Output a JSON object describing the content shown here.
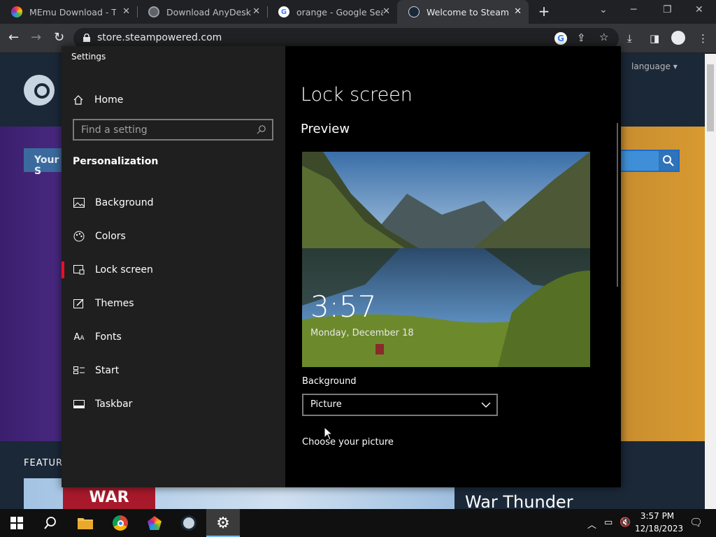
{
  "browser": {
    "tabs": [
      {
        "title": "MEmu Download - The",
        "icon": "memu-icon",
        "active": false
      },
      {
        "title": "Download AnyDesk Re",
        "icon": "globe-icon",
        "active": false
      },
      {
        "title": "orange - Google Searc",
        "icon": "google-icon",
        "active": false
      },
      {
        "title": "Welcome to Steam",
        "icon": "steam-icon",
        "active": true
      }
    ],
    "url": "store.steampowered.com"
  },
  "steam_page": {
    "your_store": "Your S",
    "language": "language",
    "featured": "FEATUR",
    "war_logo": "WAR",
    "game_title": "War Thunder"
  },
  "settings": {
    "window_title": "Settings",
    "home_label": "Home",
    "search_placeholder": "Find a setting",
    "section": "Personalization",
    "nav": [
      {
        "label": "Background",
        "icon": "picture-icon",
        "selected": false
      },
      {
        "label": "Colors",
        "icon": "palette-icon",
        "selected": false
      },
      {
        "label": "Lock screen",
        "icon": "lock-screen-icon",
        "selected": true
      },
      {
        "label": "Themes",
        "icon": "themes-icon",
        "selected": false
      },
      {
        "label": "Fonts",
        "icon": "fonts-icon",
        "selected": false
      },
      {
        "label": "Start",
        "icon": "start-icon",
        "selected": false
      },
      {
        "label": "Taskbar",
        "icon": "taskbar-icon",
        "selected": false
      }
    ],
    "page_title": "Lock screen",
    "preview_heading": "Preview",
    "preview_time": "3:57",
    "preview_date": "Monday, December 18",
    "background_label": "Background",
    "background_value": "Picture",
    "choose_label": "Choose your picture",
    "accent_color": "#e81123"
  },
  "taskbar": {
    "apps": [
      "start-icon",
      "search-icon",
      "file-explorer-icon",
      "chrome-icon",
      "memu-icon",
      "steam-icon",
      "settings-icon"
    ],
    "time": "3:57 PM",
    "date": "12/18/2023"
  }
}
